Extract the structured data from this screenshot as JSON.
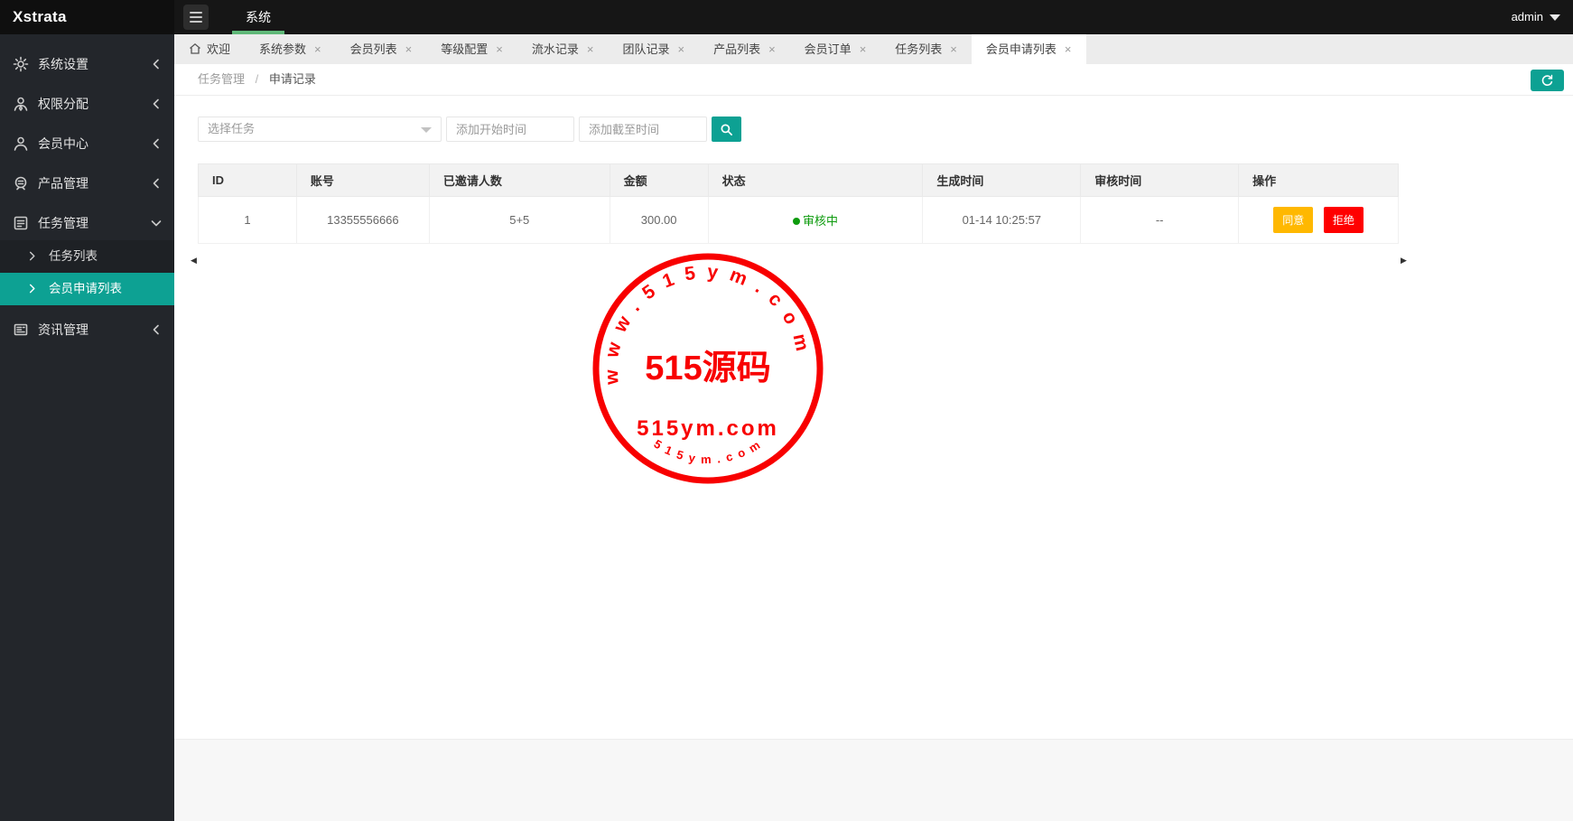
{
  "app": {
    "logo": "Xstrata",
    "top_tab": "系统",
    "user": "admin"
  },
  "icons": {
    "close": "×",
    "scroll_left": "◀",
    "scroll_right": "▶"
  },
  "colors": {
    "accent_teal": "#0DA193",
    "tab_green": "#5FB878",
    "status_green": "#0E9B0E",
    "approve_orange": "#FFB800",
    "reject_red": "#FF0000",
    "amount_red": "#FF0000",
    "stamp_red": "#F80000"
  },
  "sidebar": {
    "items": [
      {
        "label": "系统设置"
      },
      {
        "label": "权限分配"
      },
      {
        "label": "会员中心"
      },
      {
        "label": "产品管理"
      },
      {
        "label": "任务管理"
      },
      {
        "label": "资讯管理"
      }
    ],
    "children": [
      {
        "label": "任务列表"
      },
      {
        "label": "会员申请列表"
      }
    ]
  },
  "tabs": [
    {
      "label": "欢迎"
    },
    {
      "label": "系统参数"
    },
    {
      "label": "会员列表"
    },
    {
      "label": "等级配置"
    },
    {
      "label": "流水记录"
    },
    {
      "label": "团队记录"
    },
    {
      "label": "产品列表"
    },
    {
      "label": "会员订单"
    },
    {
      "label": "任务列表"
    },
    {
      "label": "会员申请列表"
    }
  ],
  "breadcrumb": {
    "parent": "任务管理",
    "separator": "/",
    "current": "申请记录"
  },
  "filters": {
    "task_select_placeholder": "选择任务",
    "start_time_placeholder": "添加开始时间",
    "end_time_placeholder": "添加截至时间"
  },
  "table": {
    "columns": [
      "ID",
      "账号",
      "已邀请人数",
      "金额",
      "状态",
      "生成时间",
      "审核时间",
      "操作"
    ],
    "rows": [
      {
        "id": "1",
        "account": "13355556666",
        "invited": "5+5",
        "amount": "300.00",
        "status": "审核中",
        "created": "01-14 10:25:57",
        "reviewed": "--",
        "approve": "同意",
        "reject": "拒绝"
      }
    ]
  },
  "watermark": {
    "arc_top": "www.515ym.com",
    "center_title": "515源码",
    "center_sub": "515ym.com",
    "arc_bottom": "515ym.com"
  }
}
